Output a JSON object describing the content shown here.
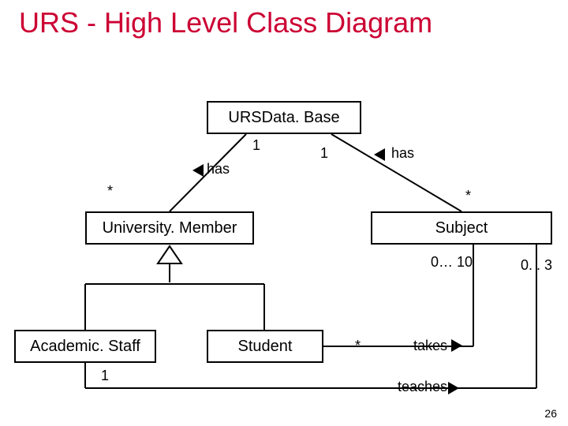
{
  "title": "URS - High Level Class Diagram",
  "classes": {
    "ursdb": "URSData. Base",
    "umember": "University. Member",
    "subject": "Subject",
    "academic": "Academic. Staff",
    "student": "Student"
  },
  "labels": {
    "one_a": "1",
    "one_b": "1",
    "has_a": "has",
    "has_b": "has",
    "star_a": "*",
    "star_b": "*",
    "star_c": "*",
    "mult_010": "0… 10",
    "mult_03": "0. . 3",
    "takes": "takes",
    "teaches": "teaches",
    "one_c": "1"
  },
  "page": "26"
}
